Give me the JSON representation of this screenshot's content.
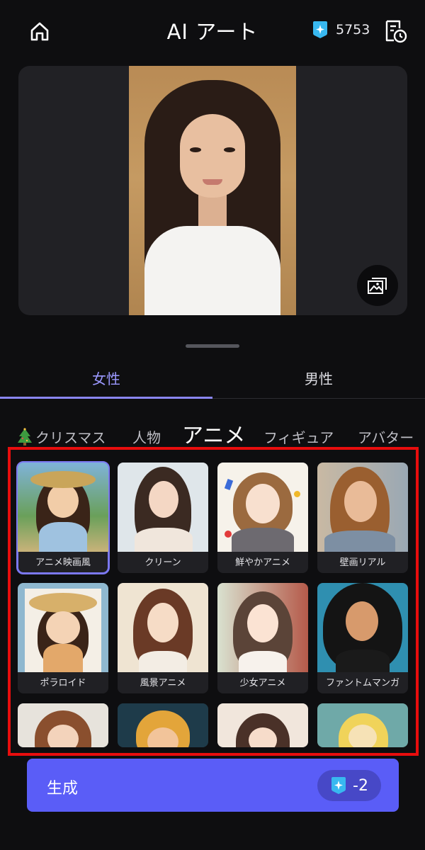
{
  "header": {
    "title": "AI アート",
    "credits": "5753"
  },
  "gender_tabs": [
    {
      "label": "女性",
      "active": true
    },
    {
      "label": "男性",
      "active": false
    }
  ],
  "categories": [
    {
      "label": "クリスマス",
      "icon": "christmas-tree-icon"
    },
    {
      "label": "人物"
    },
    {
      "label": "アニメ",
      "active": true
    },
    {
      "label": "フィギュア"
    },
    {
      "label": "アバター"
    }
  ],
  "styles": [
    {
      "label": "アニメ映画風",
      "selected": true
    },
    {
      "label": "クリーン"
    },
    {
      "label": "鮮やかアニメ"
    },
    {
      "label": "壁画リアル"
    },
    {
      "label": "ポラロイド"
    },
    {
      "label": "風景アニメ"
    },
    {
      "label": "少女アニメ"
    },
    {
      "label": "ファントムマンガ"
    }
  ],
  "generate": {
    "label": "生成",
    "cost": "-2"
  },
  "colors": {
    "accent": "#5a5df7",
    "selection_frame": "#e80d0d",
    "active_tab": "#9b98ff"
  }
}
